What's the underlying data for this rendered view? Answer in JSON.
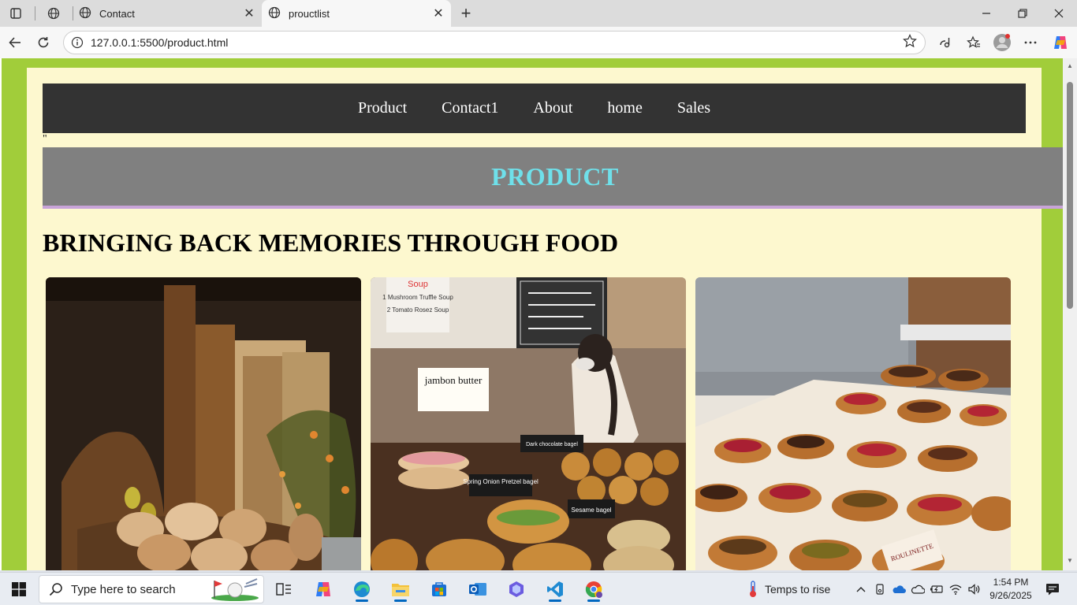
{
  "browser": {
    "tabs": [
      {
        "title": "Contact",
        "active": false
      },
      {
        "title": "prouctlist",
        "active": true
      }
    ],
    "url": "127.0.0.1:5500/product.html"
  },
  "page": {
    "nav": [
      "Product",
      "Contact1",
      "About",
      "home",
      "Sales"
    ],
    "stray_text": "\"",
    "banner_title": "PRODUCT",
    "headline": "BRINGING BACK MEMORIES THROUGH FOOD",
    "colors": {
      "outer_border": "#a1cd3a",
      "inner_bg": "#fdf8cf",
      "nav_bg": "#333333",
      "banner_bg": "#808080",
      "banner_text": "#6fe0ea",
      "banner_border": "#c8a3d8"
    },
    "cards": [
      {
        "name": "rustic-bread-basket"
      },
      {
        "name": "bakery-counter-with-bagels"
      },
      {
        "name": "danish-pastry-display"
      }
    ],
    "card_texts": [
      "Soup",
      "1 Mushroom Truffle Soup",
      "2 Tomato Rosez Soup",
      "jambon butter",
      "Dark chocolate bagel",
      "Spring Onion Pretzel bagel",
      "Sesame bagel",
      "ROULINETTE"
    ]
  },
  "taskbar": {
    "search_placeholder": "Type here to search",
    "weather": "Temps to rise",
    "time": "1:54 PM",
    "date": "9/26/2025"
  }
}
